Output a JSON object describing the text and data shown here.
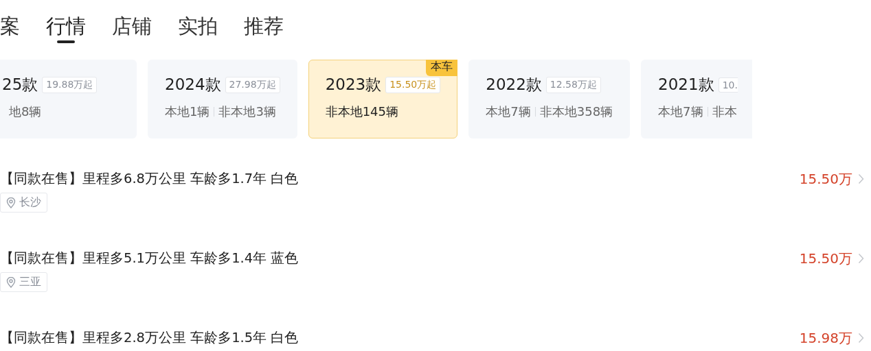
{
  "tabs": [
    {
      "label": "案",
      "selected": false
    },
    {
      "label": "行情",
      "selected": true
    },
    {
      "label": "店铺",
      "selected": false
    },
    {
      "label": "实拍",
      "selected": false
    },
    {
      "label": "推荐",
      "selected": false
    }
  ],
  "model_years": [
    {
      "year": "25款",
      "price_tag": "19.88万起",
      "stats": [
        "地8辆"
      ],
      "selected": false,
      "kind": "cut-left"
    },
    {
      "year": "2024款",
      "price_tag": "27.98万起",
      "stats": [
        "本地1辆",
        "非本地3辆"
      ],
      "selected": false,
      "kind": "full"
    },
    {
      "year": "2023款",
      "price_tag": "15.50万起",
      "stats": [
        "非本地145辆"
      ],
      "selected": true,
      "badge": "本车",
      "kind": "full"
    },
    {
      "year": "2022款",
      "price_tag": "12.58万起",
      "stats": [
        "本地7辆",
        "非本地358辆"
      ],
      "selected": false,
      "kind": "full"
    },
    {
      "year": "2021款",
      "price_tag": "10.",
      "stats": [
        "本地7辆",
        "非本"
      ],
      "selected": false,
      "kind": "cut-right"
    }
  ],
  "listings": [
    {
      "title": "【同款在售】里程多6.8万公里 车龄多1.7年 白色",
      "location": "长沙",
      "price": "15.50万"
    },
    {
      "title": "【同款在售】里程多5.1万公里 车龄多1.4年 蓝色",
      "location": "三亚",
      "price": "15.50万"
    },
    {
      "title": "【同款在售】里程多2.8万公里 车龄多1.5年 白色",
      "price": "15.98万"
    }
  ]
}
